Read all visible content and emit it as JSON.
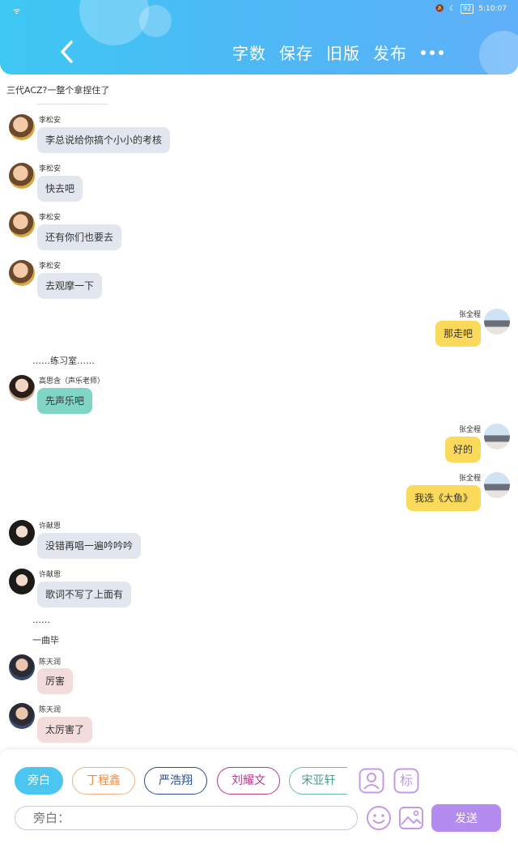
{
  "status": {
    "left": "ᯤ",
    "battery": "92",
    "time": "5:10:07"
  },
  "header": {
    "actions": [
      "字数",
      "保存",
      "旧版",
      "发布"
    ]
  },
  "intro_note": "三代ACZ?一整个拿捏住了",
  "messages": [
    {
      "name": "李松安",
      "text": "李总说给你搞个小小的考核"
    },
    {
      "name": "李松安",
      "text": "快去吧"
    },
    {
      "name": "李松安",
      "text": "还有你们也要去"
    },
    {
      "name": "李松安",
      "text": "去观摩一下"
    },
    {
      "name": "张全程",
      "text": "那走吧"
    },
    {
      "name": "高思含（声乐老师）",
      "text": "先声乐吧"
    },
    {
      "name": "张全程",
      "text": "好的"
    },
    {
      "name": "张全程",
      "text": "我选《大鱼》"
    },
    {
      "name": "许献恩",
      "text": "没错再唱一遍吟吟吟"
    },
    {
      "name": "许献恩",
      "text": "歌词不写了上面有"
    },
    {
      "name": "陈天润",
      "text": "厉害"
    },
    {
      "name": "陈天润",
      "text": "太厉害了"
    }
  ],
  "narration": {
    "practice": "……练习室……",
    "dots": "……",
    "song": "一曲毕"
  },
  "composer": {
    "chips": [
      "旁白",
      "丁程鑫",
      "严浩翔",
      "刘耀文",
      "宋亚轩"
    ],
    "input_placeholder": "旁白：",
    "send_label": "发送",
    "icons": [
      "person-icon",
      "tag-icon",
      "emoji-icon",
      "image-icon"
    ],
    "tag_label": "标"
  },
  "colors": {
    "accent": "#4cc6f1",
    "send": "#b48cf0",
    "bubble_gray": "#e2e6ee",
    "bubble_yellow": "#fbd95a",
    "bubble_teal": "#7fd6c6",
    "bubble_pink": "#f3dcdb"
  }
}
